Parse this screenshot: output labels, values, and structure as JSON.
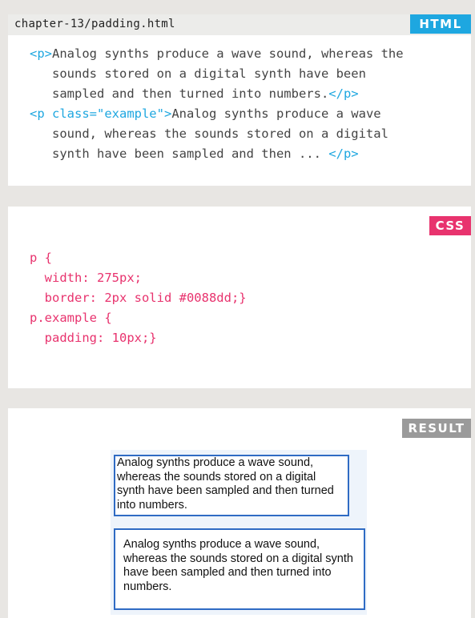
{
  "html_panel": {
    "file_name": "chapter-13/padding.html",
    "tag": "HTML",
    "code_lines": [
      [
        {
          "t": "<p>",
          "c": "blue"
        },
        {
          "t": "Analog synths produce a wave sound, whereas the",
          "c": ""
        }
      ],
      [
        {
          "t": "   sounds stored on a digital synth have been",
          "c": ""
        }
      ],
      [
        {
          "t": "   sampled and then turned into numbers.",
          "c": ""
        },
        {
          "t": "</p>",
          "c": "blue"
        }
      ],
      [
        {
          "t": "<p class=\"example\">",
          "c": "blue"
        },
        {
          "t": "Analog synths produce a wave",
          "c": ""
        }
      ],
      [
        {
          "t": "   sound, whereas the sounds stored on a digital",
          "c": ""
        }
      ],
      [
        {
          "t": "   synth have been sampled and then ... ",
          "c": ""
        },
        {
          "t": "</p>",
          "c": "blue"
        }
      ]
    ]
  },
  "css_panel": {
    "tag": "CSS",
    "code_lines": [
      "p {",
      "  width: 275px;",
      "  border: 2px solid #0088dd;}",
      "p.example {",
      "  padding: 10px;}"
    ]
  },
  "result_panel": {
    "tag": "RESULT",
    "paragraph_1": "Analog synths produce a wave sound, whereas the sounds stored on a digital synth have been sampled and then turned into numbers.",
    "paragraph_2": "Analog synths produce a wave sound, whereas the sounds stored on a digital synth have been sampled and then turned into numbers."
  },
  "colors": {
    "html_tag": "#1ea7e0",
    "css_tag": "#e8336e",
    "result_tag": "#9a9a9a",
    "demo_border": "#2f6bc4"
  }
}
